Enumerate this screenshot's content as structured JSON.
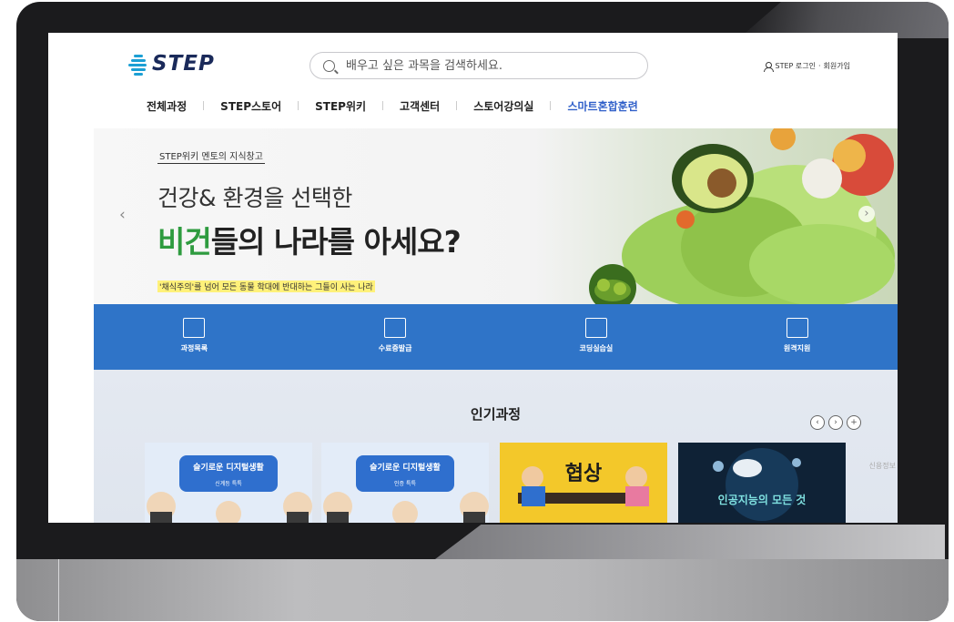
{
  "header": {
    "logo_text": "STEP",
    "search": {
      "placeholder": "배우고 싶은 과목을 검색하세요."
    },
    "login_label": "STEP 로그인",
    "divider": "·",
    "signup_label": "회원가입"
  },
  "nav": {
    "items": [
      {
        "label": "전체과정"
      },
      {
        "label": "STEP스토어"
      },
      {
        "label": "STEP위키"
      },
      {
        "label": "고객센터"
      },
      {
        "label": "스토어강의실"
      },
      {
        "label": "스마트혼합훈련"
      }
    ]
  },
  "hero": {
    "tag": "STEP위키 멘토의 지식창고",
    "subtitle": "건강& 환경을 선택한",
    "title_accent": "비건",
    "title_rest": "들의 나라를 아세요?",
    "description": "'채식주의'를 넘어 모든 동물 학대에 반대하는 그들이 사는 나라",
    "prev_arrow": "‹",
    "next_arrow": "›"
  },
  "quick_menu": [
    {
      "label": "과정목록",
      "icon": "book-icon"
    },
    {
      "label": "수료증발급",
      "icon": "certificate-icon"
    },
    {
      "label": "코딩실습실",
      "icon": "keyboard-icon"
    },
    {
      "label": "원격지원",
      "icon": "remote-support-icon"
    }
  ],
  "popular": {
    "title": "인기과정",
    "prev": "‹",
    "next": "›",
    "add": "+",
    "cards": [
      {
        "title": "슬기로운 디지털생활",
        "sub": "신계등 특특"
      },
      {
        "title": "슬기로운 디지털생활",
        "sub": "인증 특특"
      },
      {
        "title": "협상"
      },
      {
        "title": "인공지능의 모든 것"
      }
    ],
    "side_text": "신용정보"
  },
  "colors": {
    "accent_blue": "#2f74c8",
    "accent_green": "#2e9b3f",
    "logo_navy": "#1a2a5a"
  }
}
